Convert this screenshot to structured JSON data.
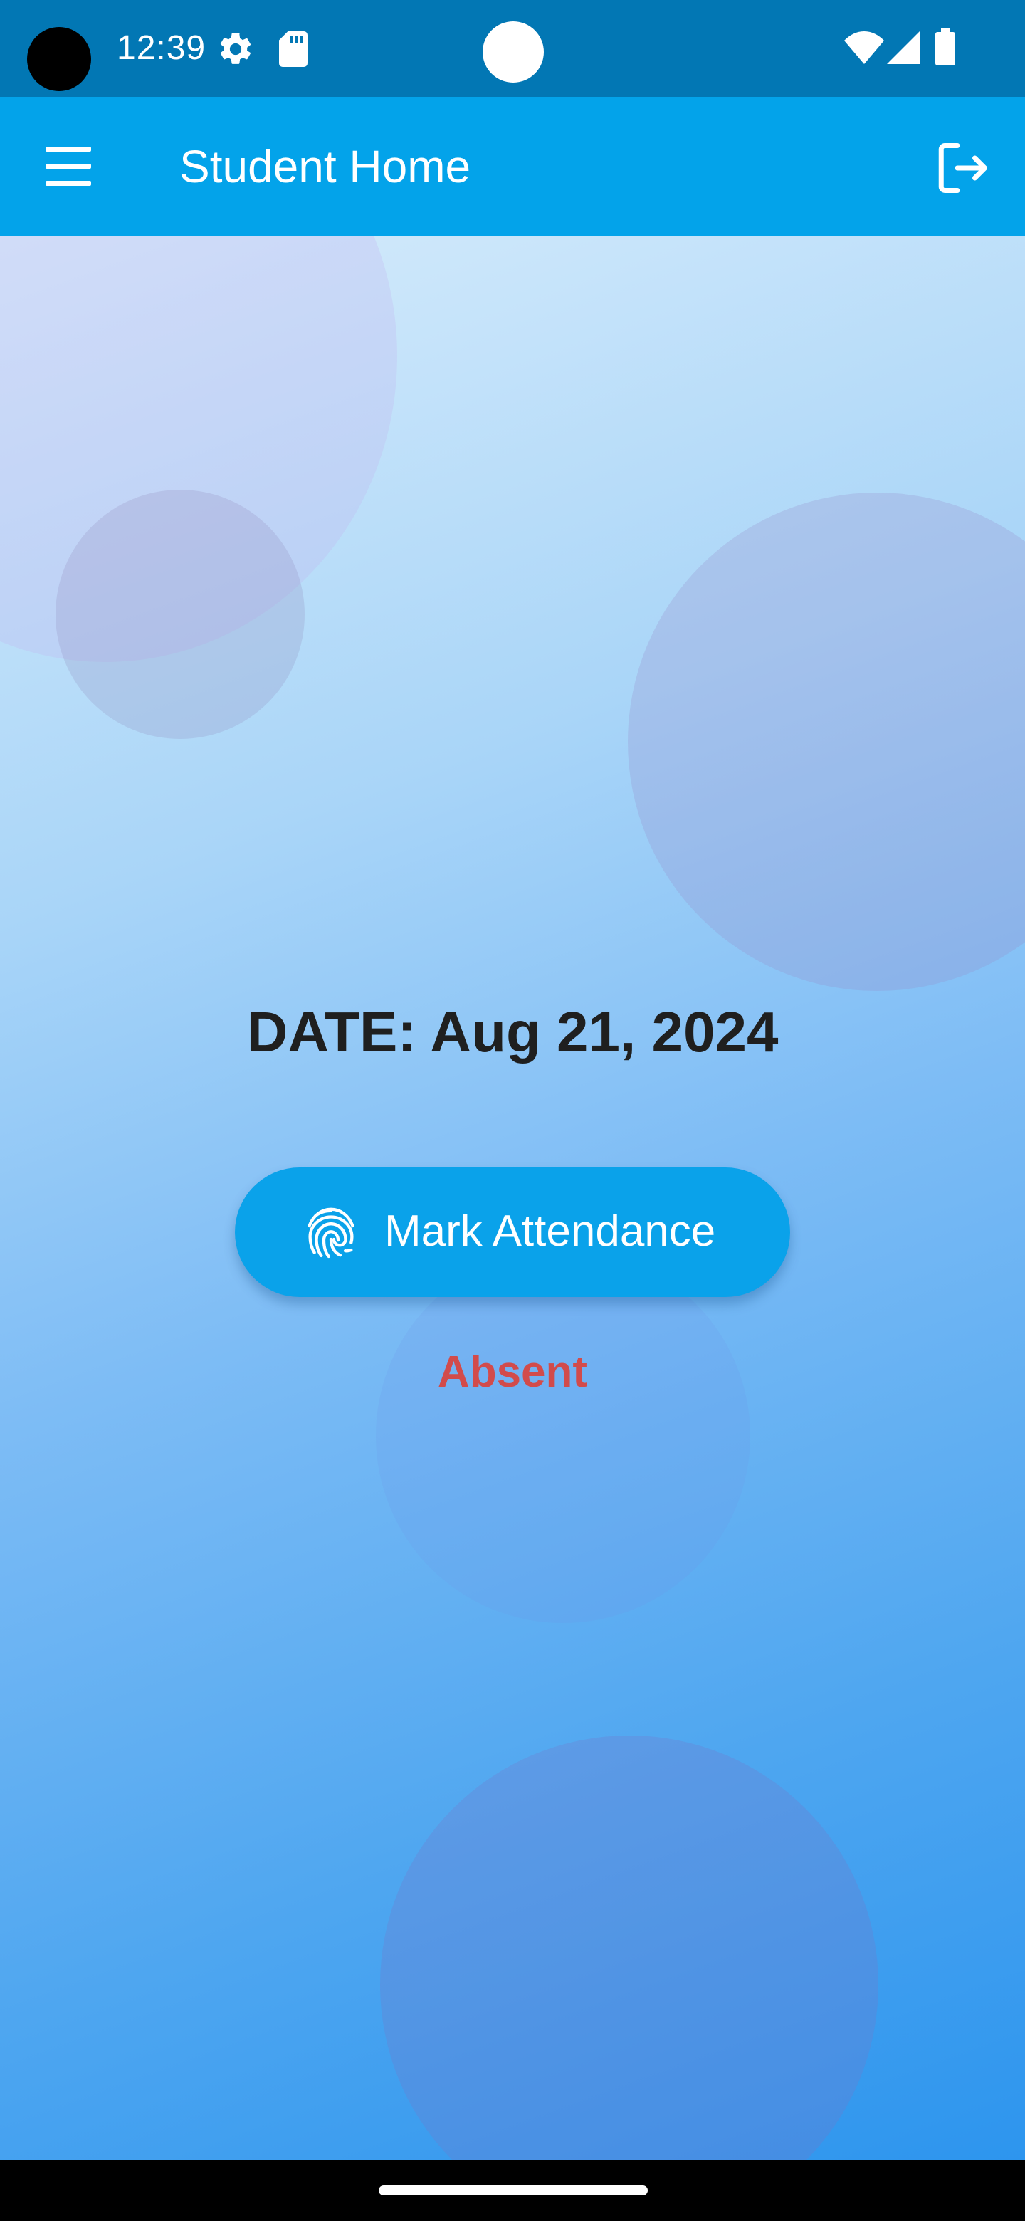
{
  "status_bar": {
    "time": "12:39",
    "icons": [
      "camera-hole",
      "settings-icon",
      "sd-card-icon",
      "wifi-icon",
      "signal-icon",
      "battery-icon"
    ]
  },
  "app_bar": {
    "title": "Student Home",
    "menu_icon": "menu-icon",
    "logout_icon": "logout-icon"
  },
  "main": {
    "date_text": "DATE: Aug 21, 2024",
    "mark_button_label": "Mark Attendance",
    "mark_button_icon": "fingerprint-icon",
    "attendance_status": "Absent"
  },
  "colors": {
    "status_bar": "#0277b4",
    "app_bar": "#03a3ea",
    "button": "#0aa2ea",
    "absent_text": "#d24b4b"
  }
}
